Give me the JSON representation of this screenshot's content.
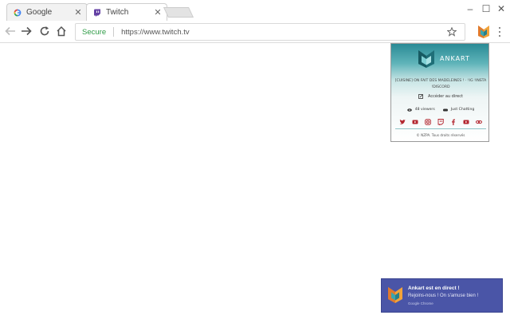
{
  "browser": {
    "tabs": [
      {
        "label": "Google",
        "icon": "google-icon",
        "active": false
      },
      {
        "label": "Twitch",
        "icon": "twitch-icon",
        "active": true
      }
    ],
    "tab_close_glyph": "✕",
    "window_controls": {
      "minimize": "–",
      "maximize": "☐",
      "close": "✕"
    },
    "omnibox": {
      "secure_label": "Secure",
      "url": "https://www.twitch.tv"
    }
  },
  "popup": {
    "channel_name": "ANKART",
    "status_text": "[CUISINE] ON FAIT DES MADELEINES ! · !IG !INSTA !DISCORD",
    "live_link": "Accéder au direct",
    "viewers": "48 viewers",
    "category": "Just Chatting",
    "social_icons": [
      "twitter-icon",
      "youtube-icon",
      "instagram-icon",
      "twitch-icon",
      "facebook-icon",
      "youtube-icon",
      "link-icon"
    ],
    "footer": "© NZPA. Tous droits réservés"
  },
  "notification": {
    "title": "Ankart est en direct !",
    "body": "Rejoins-nous ! On s'amuse bien !",
    "source": "Google Chrome"
  },
  "colors": {
    "notification_bg": "#4a55a7",
    "secure_green": "#2e9b46",
    "twitch_purple": "#6441a4",
    "popup_teal": "#2a8a95",
    "social_red": "#b3262f"
  }
}
